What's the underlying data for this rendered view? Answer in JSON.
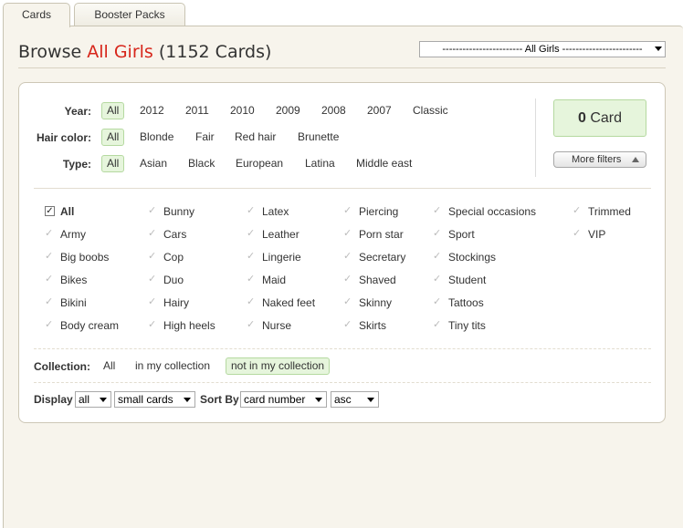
{
  "tabs": [
    {
      "label": "Cards",
      "active": true
    },
    {
      "label": "Booster Packs",
      "active": false
    }
  ],
  "title": {
    "prefix": "Browse ",
    "highlight": "All Girls",
    "suffix": " (1152 Cards)"
  },
  "girl_select": {
    "value": "------------------------ All Girls ------------------------"
  },
  "filters": {
    "year": {
      "label": "Year:",
      "options": [
        "All",
        "2012",
        "2011",
        "2010",
        "2009",
        "2008",
        "2007",
        "Classic"
      ],
      "selected": "All"
    },
    "hair": {
      "label": "Hair color:",
      "options": [
        "All",
        "Blonde",
        "Fair",
        "Red hair",
        "Brunette"
      ],
      "selected": "All"
    },
    "type": {
      "label": "Type:",
      "options": [
        "All",
        "Asian",
        "Black",
        "European",
        "Latina",
        "Middle east"
      ],
      "selected": "All"
    }
  },
  "card_count": {
    "number": "0",
    "label": " Card"
  },
  "more_filters": {
    "label": "More filters"
  },
  "categories": {
    "columns": [
      [
        "All",
        "Army",
        "Big boobs",
        "Bikes",
        "Bikini",
        "Body cream"
      ],
      [
        "Bunny",
        "Cars",
        "Cop",
        "Duo",
        "Hairy",
        "High heels"
      ],
      [
        "Latex",
        "Leather",
        "Lingerie",
        "Maid",
        "Naked feet",
        "Nurse"
      ],
      [
        "Piercing",
        "Porn star",
        "Secretary",
        "Shaved",
        "Skinny",
        "Skirts"
      ],
      [
        "Special occasions",
        "Sport",
        "Stockings",
        "Student",
        "Tattoos",
        "Tiny tits"
      ],
      [
        "Trimmed",
        "VIP"
      ]
    ],
    "checked": "All"
  },
  "collection": {
    "label": "Collection:",
    "options": [
      "All",
      "in my collection",
      "not in my collection"
    ],
    "selected": "not in my collection"
  },
  "display": {
    "label": "Display",
    "count": "all",
    "size": "small cards",
    "sort_label": "Sort By",
    "sort_field": "card number",
    "order": "asc"
  },
  "colors": {
    "accent": "#d7261b",
    "selected_bg": "#e6f5dc",
    "selected_border": "#b5d9a0",
    "frame_bg": "#f7f4ec"
  }
}
